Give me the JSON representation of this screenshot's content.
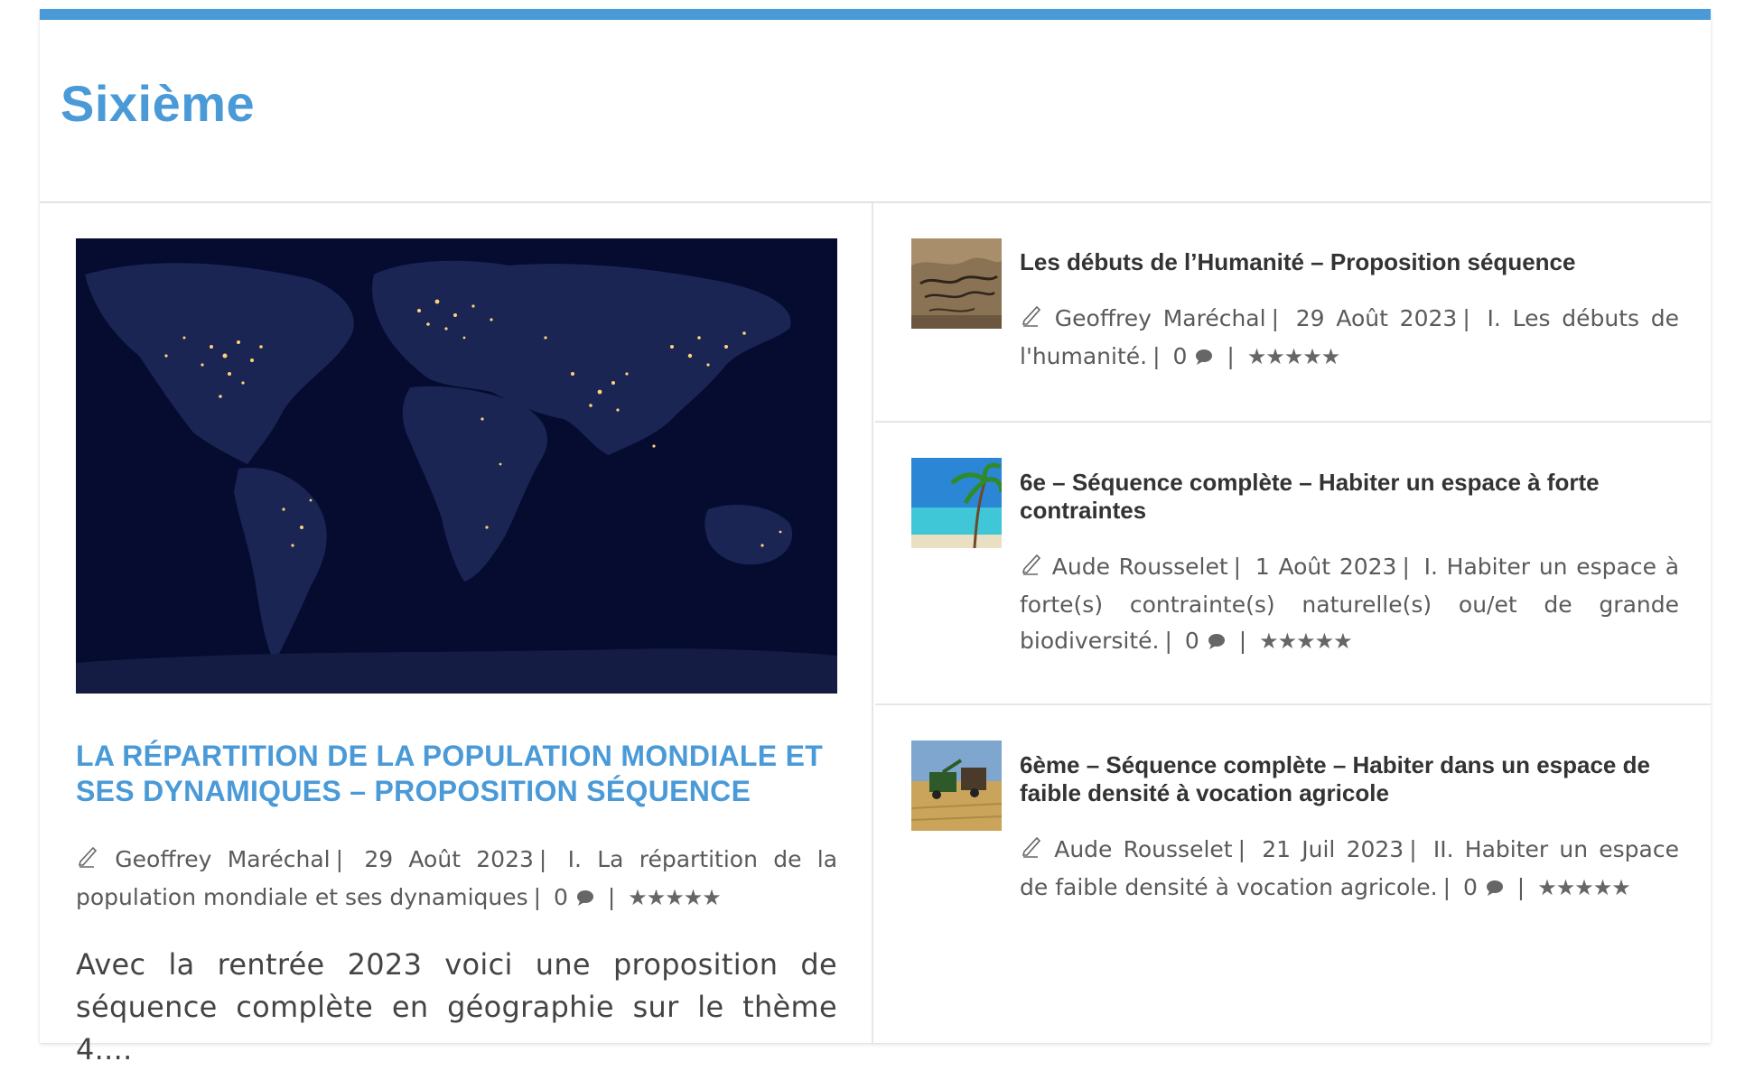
{
  "section": {
    "title": "Sixième"
  },
  "featured": {
    "title": "La répartition de la population mondiale et ses dynamiques – Proposition séquence",
    "author": "Geoffrey Maréchal",
    "date": "29 Août 2023",
    "category": "I. La répartition de la population mondiale et ses dynamiques",
    "comments": "0",
    "excerpt": "Avec la rentrée 2023 voici une proposition de séquence complète en géographie sur le thème 4...."
  },
  "items": [
    {
      "title": "Les débuts de l’Humanité – Proposition séquence",
      "author": "Geoffrey Maréchal",
      "date": "29 Août 2023",
      "category": "I. Les débuts de l'humanité.",
      "comments": "0"
    },
    {
      "title": "6e – Séquence complète – Habiter un espace à forte contraintes",
      "author": "Aude Rousselet",
      "date": "1 Août 2023",
      "category": "I. Habiter un espace à forte(s) contrainte(s) naturelle(s) ou/et de grande biodiversité.",
      "comments": "0"
    },
    {
      "title": "6ème – Séquence complète – Habiter dans un espace de faible densité à vocation agricole",
      "author": "Aude Rousselet",
      "date": "21 Juil 2023",
      "category": "II. Habiter un espace de faible densité à vocation agricole.",
      "comments": "0"
    }
  ],
  "rating": {
    "stars": "★★★★★"
  },
  "colors": {
    "accent": "#4a9ad8",
    "text": "#555555",
    "heading": "#333333"
  },
  "icons": {
    "author": "pen-icon",
    "comments": "comment-icon",
    "rating": "star-icon"
  }
}
